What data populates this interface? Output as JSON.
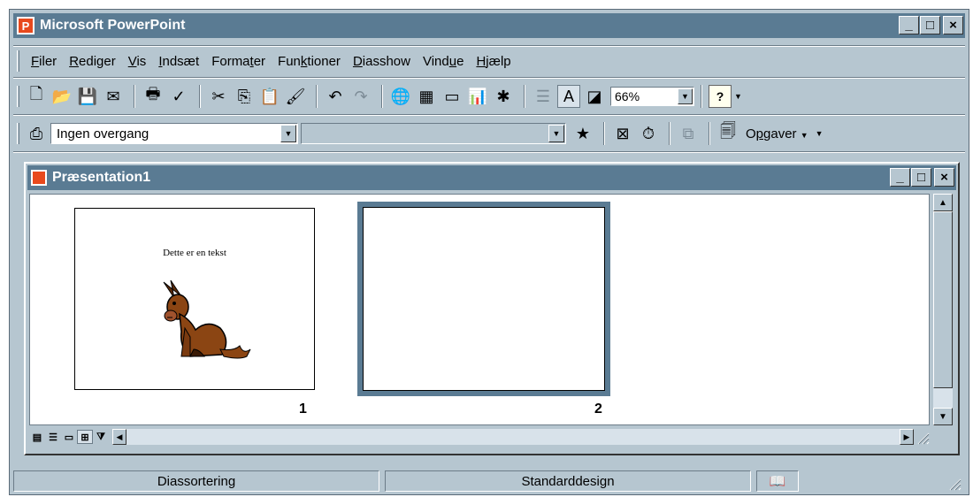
{
  "window": {
    "title": "Microsoft PowerPoint"
  },
  "window_buttons": {
    "minimize": "_",
    "maximize": "□",
    "close": "×"
  },
  "menu": {
    "items": [
      {
        "accel": "F",
        "rest": "iler"
      },
      {
        "accel": "R",
        "rest": "ediger"
      },
      {
        "accel": "V",
        "rest": "is"
      },
      {
        "accel": "I",
        "rest": "ndsæt"
      },
      {
        "pre": "Forma",
        "accel": "t",
        "rest": "er"
      },
      {
        "pre": "Fun",
        "accel": "k",
        "rest": "tioner"
      },
      {
        "accel": "D",
        "rest": "iasshow"
      },
      {
        "pre": "Vind",
        "accel": "u",
        "rest": "e"
      },
      {
        "accel": "H",
        "rest": "jælp"
      }
    ]
  },
  "standard_toolbar": {
    "zoom_value": "66%"
  },
  "formatting_toolbar": {
    "transition_value": "Ingen overgang",
    "effect_value": "",
    "tasks_pre": "O",
    "tasks_accel": "p",
    "tasks_rest": "gaver"
  },
  "document": {
    "title": "Præsentation1",
    "slides": [
      {
        "number": "1",
        "text": "Dette er en tekst",
        "has_clipart": true
      },
      {
        "number": "2",
        "text": "",
        "selected": true
      }
    ]
  },
  "status_bar": {
    "view_name": "Diassortering",
    "design_name": "Standarddesign"
  },
  "colors": {
    "title_bar": "#5a7b93",
    "chrome": "#b6c6d0",
    "app_icon": "#e8491d"
  }
}
